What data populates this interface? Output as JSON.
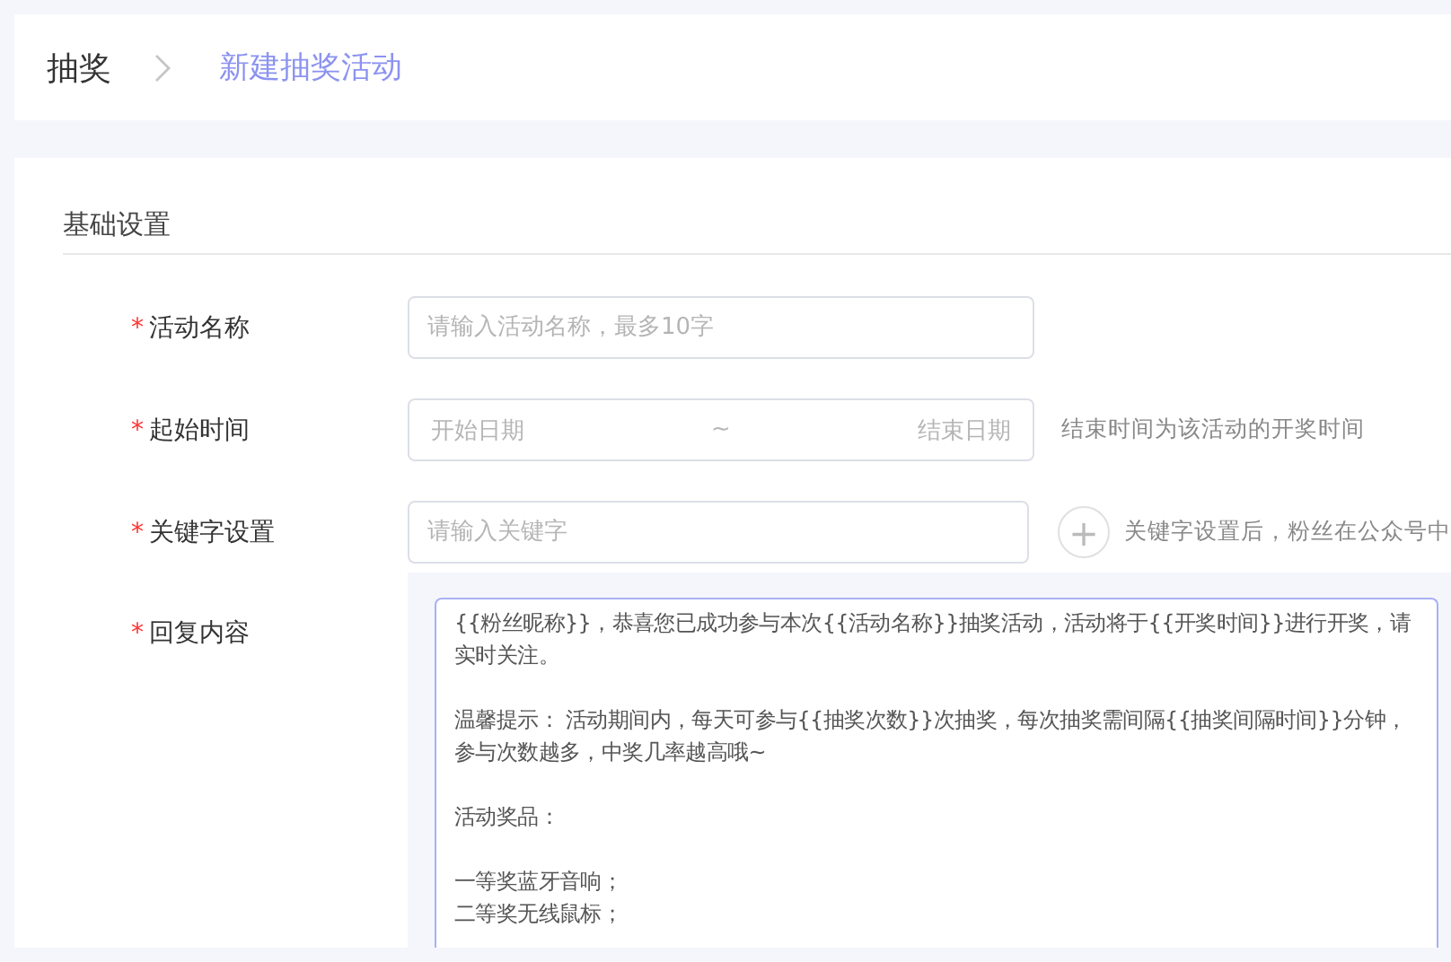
{
  "breadcrumb": [
    {
      "label": "抽奖",
      "current": false
    },
    {
      "label": "新建抽奖活动",
      "current": true
    }
  ],
  "section": {
    "title": "基础设置"
  },
  "fields": [
    {
      "kind": "text",
      "label": "活动名称",
      "required_mark": "*",
      "placeholder": "请输入活动名称，最多10字"
    },
    {
      "kind": "daterange",
      "label": "起始时间",
      "required_mark": "*",
      "start_placeholder": "开始日期",
      "separator": "~",
      "end_placeholder": "结束日期",
      "hint": "结束时间为该活动的开奖时间"
    },
    {
      "kind": "keyword",
      "label": "关键字设置",
      "required_mark": "*",
      "placeholder": "请输入关键字",
      "add_icon": "+",
      "hint": "关键字设置后，粉丝在公众号中"
    },
    {
      "kind": "textarea",
      "label": "回复内容",
      "required_mark": "*",
      "paragraphs": [
        [
          "{{粉丝昵称}}，恭喜您已成功参与本次{{活动名称}}抽奖活动，活动将于{{开奖时间}}进行开奖，请实时关注。"
        ],
        [
          "温馨提示： 活动期间内，每天可参与{{抽奖次数}}次抽奖，每次抽奖需间隔{{抽奖间隔时间}}分钟，参与次数越多，中奖几率越高哦~"
        ],
        [
          "活动奖品："
        ],
        [
          "一等奖蓝牙音响；",
          "二等奖无线鼠标；"
        ]
      ]
    }
  ]
}
